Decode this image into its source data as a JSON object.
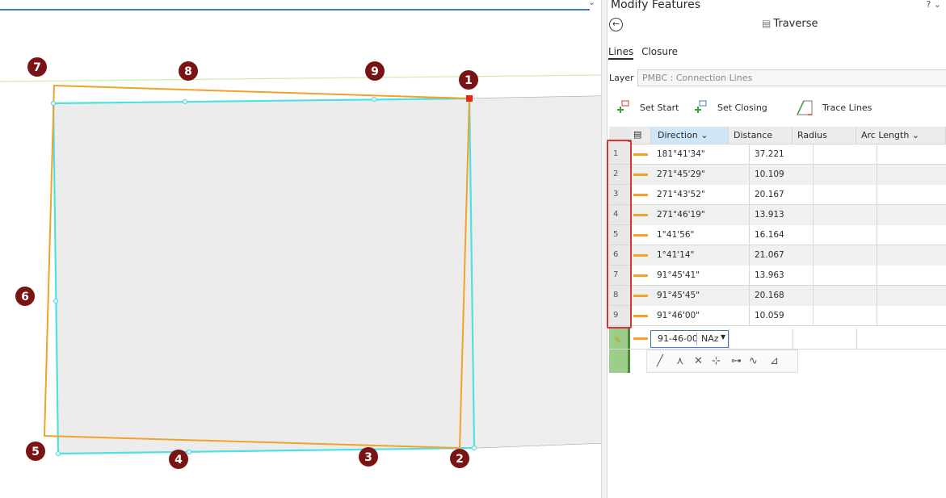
{
  "pane": {
    "title": "Modify Features",
    "help": "?",
    "collapse": "⌄",
    "traverse_title": "Traverse",
    "tabs": [
      "Lines",
      "Closure"
    ],
    "layer_label": "Layer",
    "layer_value": "PMBC : Connection Lines",
    "tools": {
      "set_start": "Set Start",
      "set_closing": "Set Closing",
      "trace_lines": "Trace Lines"
    }
  },
  "grid": {
    "headers": {
      "direction": "Direction",
      "distance": "Distance",
      "radius": "Radius",
      "arc_length": "Arc Length"
    },
    "rows": [
      {
        "num": "1",
        "direction": "181°41'34\"",
        "distance": "37.221"
      },
      {
        "num": "2",
        "direction": "271°45'29\"",
        "distance": "10.109"
      },
      {
        "num": "3",
        "direction": "271°43'52\"",
        "distance": "20.167"
      },
      {
        "num": "4",
        "direction": "271°46'19\"",
        "distance": "13.913"
      },
      {
        "num": "5",
        "direction": "1°41'56\"",
        "distance": "16.164"
      },
      {
        "num": "6",
        "direction": "1°41'14\"",
        "distance": "21.067"
      },
      {
        "num": "7",
        "direction": "91°45'41\"",
        "distance": "13.963"
      },
      {
        "num": "8",
        "direction": "91°45'45\"",
        "distance": "20.168"
      },
      {
        "num": "9",
        "direction": "91°46'00\"",
        "distance": "10.059"
      }
    ],
    "edit": {
      "value": "91-46-00",
      "unit": "NAz"
    }
  },
  "map": {
    "markers": [
      "1",
      "2",
      "3",
      "4",
      "5",
      "6",
      "7",
      "8",
      "9"
    ]
  },
  "colors": {
    "traverse": "#f0a22a",
    "parcel": "#4fe0e0",
    "marker": "#7a1414",
    "selection": "#e0302f"
  }
}
